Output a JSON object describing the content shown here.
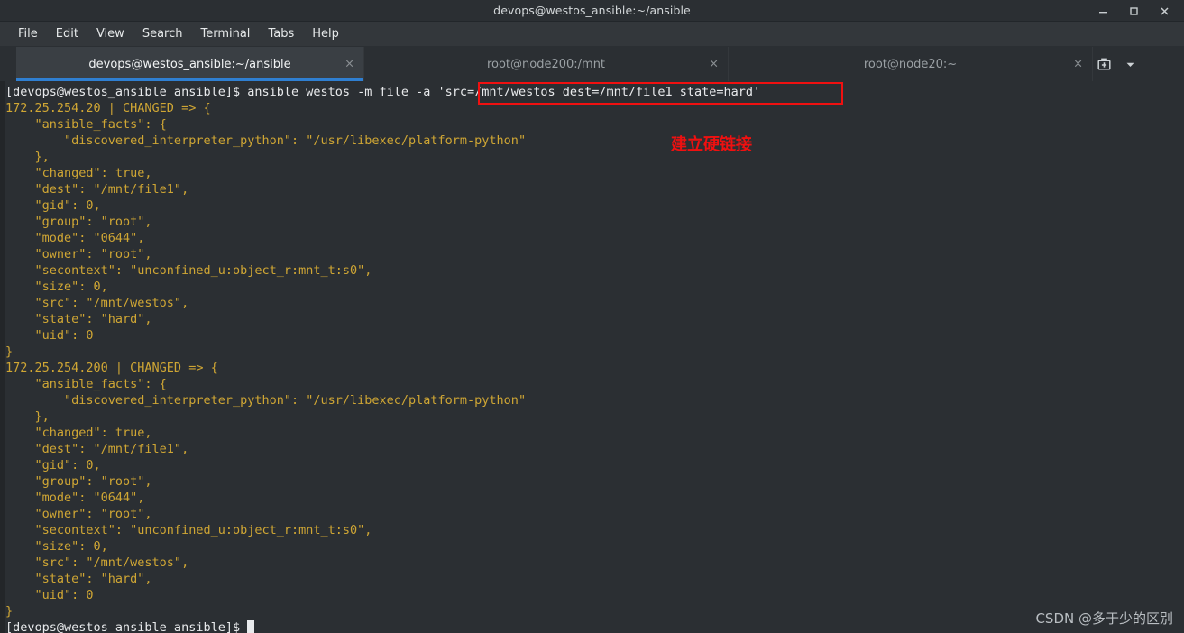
{
  "window": {
    "title": "devops@westos_ansible:~/ansible",
    "controls": [
      {
        "name": "minimize",
        "glyph": "–"
      },
      {
        "name": "maximize",
        "glyph": "□"
      },
      {
        "name": "close",
        "glyph": "✕"
      }
    ]
  },
  "menubar": {
    "items": [
      "File",
      "Edit",
      "View",
      "Search",
      "Terminal",
      "Tabs",
      "Help"
    ]
  },
  "tabs": {
    "items": [
      {
        "label": "devops@westos_ansible:~/ansible",
        "close": "×",
        "active": true
      },
      {
        "label": "root@node200:/mnt",
        "close": "×",
        "active": false
      },
      {
        "label": "root@node20:~",
        "close": "×",
        "active": false
      }
    ],
    "new_tab_icon": "new-tab-icon",
    "tab_menu_icon": "chevron-down-icon"
  },
  "terminal": {
    "lines": [
      {
        "kind": "prompt",
        "text": "[devops@westos_ansible ansible]$ ansible westos -m file -a 'src=/mnt/westos dest=/mnt/file1 state=hard'"
      },
      {
        "kind": "out",
        "text": "172.25.254.20 | CHANGED => {"
      },
      {
        "kind": "out",
        "text": "    \"ansible_facts\": {"
      },
      {
        "kind": "out",
        "text": "        \"discovered_interpreter_python\": \"/usr/libexec/platform-python\""
      },
      {
        "kind": "out",
        "text": "    },"
      },
      {
        "kind": "out",
        "text": "    \"changed\": true,"
      },
      {
        "kind": "out",
        "text": "    \"dest\": \"/mnt/file1\","
      },
      {
        "kind": "out",
        "text": "    \"gid\": 0,"
      },
      {
        "kind": "out",
        "text": "    \"group\": \"root\","
      },
      {
        "kind": "out",
        "text": "    \"mode\": \"0644\","
      },
      {
        "kind": "out",
        "text": "    \"owner\": \"root\","
      },
      {
        "kind": "out",
        "text": "    \"secontext\": \"unconfined_u:object_r:mnt_t:s0\","
      },
      {
        "kind": "out",
        "text": "    \"size\": 0,"
      },
      {
        "kind": "out",
        "text": "    \"src\": \"/mnt/westos\","
      },
      {
        "kind": "out",
        "text": "    \"state\": \"hard\","
      },
      {
        "kind": "out",
        "text": "    \"uid\": 0"
      },
      {
        "kind": "out",
        "text": "}"
      },
      {
        "kind": "out",
        "text": "172.25.254.200 | CHANGED => {"
      },
      {
        "kind": "out",
        "text": "    \"ansible_facts\": {"
      },
      {
        "kind": "out",
        "text": "        \"discovered_interpreter_python\": \"/usr/libexec/platform-python\""
      },
      {
        "kind": "out",
        "text": "    },"
      },
      {
        "kind": "out",
        "text": "    \"changed\": true,"
      },
      {
        "kind": "out",
        "text": "    \"dest\": \"/mnt/file1\","
      },
      {
        "kind": "out",
        "text": "    \"gid\": 0,"
      },
      {
        "kind": "out",
        "text": "    \"group\": \"root\","
      },
      {
        "kind": "out",
        "text": "    \"mode\": \"0644\","
      },
      {
        "kind": "out",
        "text": "    \"owner\": \"root\","
      },
      {
        "kind": "out",
        "text": "    \"secontext\": \"unconfined_u:object_r:mnt_t:s0\","
      },
      {
        "kind": "out",
        "text": "    \"size\": 0,"
      },
      {
        "kind": "out",
        "text": "    \"src\": \"/mnt/westos\","
      },
      {
        "kind": "out",
        "text": "    \"state\": \"hard\","
      },
      {
        "kind": "out",
        "text": "    \"uid\": 0"
      },
      {
        "kind": "out",
        "text": "}"
      },
      {
        "kind": "prompt_cursor",
        "text": "[devops@westos_ansible ansible]$ "
      }
    ]
  },
  "annotations": {
    "highlight_box_text": "'src=/mnt/westos dest=/mnt/file1 state=hard'",
    "note_text": "建立硬链接",
    "watermark": "CSDN @多于少的区别"
  },
  "colors": {
    "accent_tab_underline": "#2f7fd1",
    "terminal_bg": "#2b2f33",
    "output_text": "#cfa634",
    "prompt_text": "#e8eaec",
    "annotation_red": "#f01010"
  }
}
